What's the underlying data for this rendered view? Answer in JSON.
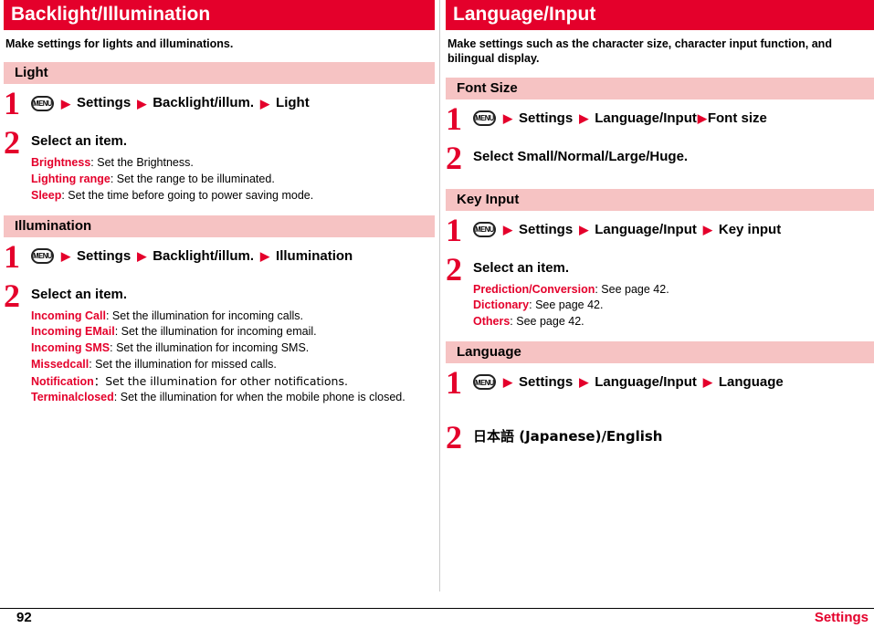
{
  "footer": {
    "page_number": "92",
    "label": "Settings"
  },
  "left": {
    "title": "Backlight/Illumination",
    "intro": "Make settings for lights and illuminations.",
    "sections": [
      {
        "heading": "Light",
        "steps": [
          {
            "number": "1",
            "icon": "menu-key-icon",
            "parts": [
              "Settings",
              "Backlight/illum.",
              "Light"
            ]
          },
          {
            "number": "2",
            "text": "Select an item.",
            "defs": [
              {
                "term": "Brightness",
                "desc": ": Set the Brightness."
              },
              {
                "term": "Lighting range",
                "desc": ": Set the range to be illuminated."
              },
              {
                "term": "Sleep",
                "desc": ": Set the time before going to power saving mode."
              }
            ]
          }
        ]
      },
      {
        "heading": "Illumination",
        "steps": [
          {
            "number": "1",
            "icon": "menu-key-icon",
            "parts": [
              "Settings",
              "Backlight/illum.",
              "Illumination"
            ]
          },
          {
            "number": "2",
            "text": "Select an item.",
            "defs": [
              {
                "term": "Incoming Call",
                "desc": ": Set the illumination for incoming calls."
              },
              {
                "term": "Incoming EMail",
                "desc": ": Set the illumination for incoming email."
              },
              {
                "term": "Incoming SMS",
                "desc": ": Set the illumination for incoming SMS."
              },
              {
                "term": "Missedcall",
                "desc": ": Set the illumination for missed calls."
              },
              {
                "term": "Notification",
                "desc": "：Set the illumination for other notifications."
              },
              {
                "term": "Terminalclosed",
                "desc": ": Set the illumination for when the mobile phone is closed."
              }
            ]
          }
        ]
      }
    ]
  },
  "right": {
    "title": "Language/Input",
    "intro": "Make settings such as the character size, character input function, and bilingual display.",
    "sections": [
      {
        "heading": "Font Size",
        "steps": [
          {
            "number": "1",
            "icon": "menu-key-icon",
            "parts": [
              "Settings",
              "Language/Input",
              "Font size"
            ],
            "tight_last": true
          },
          {
            "number": "2",
            "text": "Select Small/Normal/Large/Huge."
          }
        ]
      },
      {
        "heading": "Key Input",
        "steps": [
          {
            "number": "1",
            "icon": "menu-key-icon",
            "parts": [
              "Settings",
              "Language/Input",
              "Key input"
            ]
          },
          {
            "number": "2",
            "text": "Select an item.",
            "defs": [
              {
                "term": "Prediction/Conversion",
                "desc": ": See page 42."
              },
              {
                "term": "Dictionary",
                "desc": ": See page 42."
              },
              {
                "term": "Others",
                "desc": ": See page 42."
              }
            ]
          }
        ]
      },
      {
        "heading": "Language",
        "steps": [
          {
            "number": "1",
            "icon": "menu-key-icon",
            "parts": [
              "Settings",
              "Language/Input",
              "Language"
            ]
          },
          {
            "number": "2",
            "text": "日本語 (Japanese)/English"
          }
        ]
      }
    ]
  },
  "icons": {
    "menu_key_glyph": "MENU"
  },
  "colors": {
    "accent_red": "#e4002b",
    "subbar_pink": "#f6c3c3"
  }
}
